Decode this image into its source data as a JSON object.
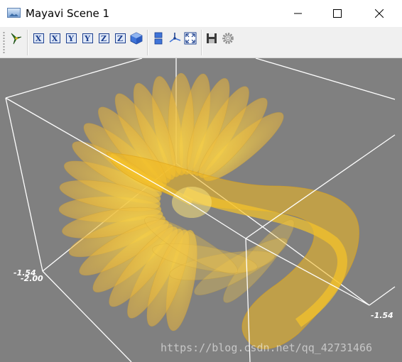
{
  "window": {
    "title": "Mayavi Scene 1",
    "controls": [
      "minimize-icon",
      "maximize-icon",
      "close-icon"
    ]
  },
  "toolbar": {
    "buttons": [
      {
        "name": "mayavi-pipeline-icon",
        "label": ""
      },
      {
        "name": "view-x-plus",
        "label": "X"
      },
      {
        "name": "view-x-minus",
        "label": "X"
      },
      {
        "name": "view-y-plus",
        "label": "Y"
      },
      {
        "name": "view-y-minus",
        "label": "Y"
      },
      {
        "name": "view-z-plus",
        "label": "Z"
      },
      {
        "name": "view-z-minus",
        "label": "Z"
      },
      {
        "name": "isometric-view-icon",
        "label": ""
      },
      {
        "name": "parallel-projection-icon",
        "label": ""
      },
      {
        "name": "axes-indicator-icon",
        "label": ""
      },
      {
        "name": "full-screen-icon",
        "label": ""
      },
      {
        "name": "save-icon",
        "label": ""
      },
      {
        "name": "settings-icon",
        "label": ""
      }
    ]
  },
  "scene": {
    "background_color": "#808080",
    "surface_color": "#f2c233",
    "outline_color": "#ffffff",
    "axis_labels": {
      "left_top": "-1.54",
      "left_bottom": "-2.00",
      "right": "-1.54"
    }
  },
  "watermark": "https://blog.csdn.net/qq_42731466"
}
